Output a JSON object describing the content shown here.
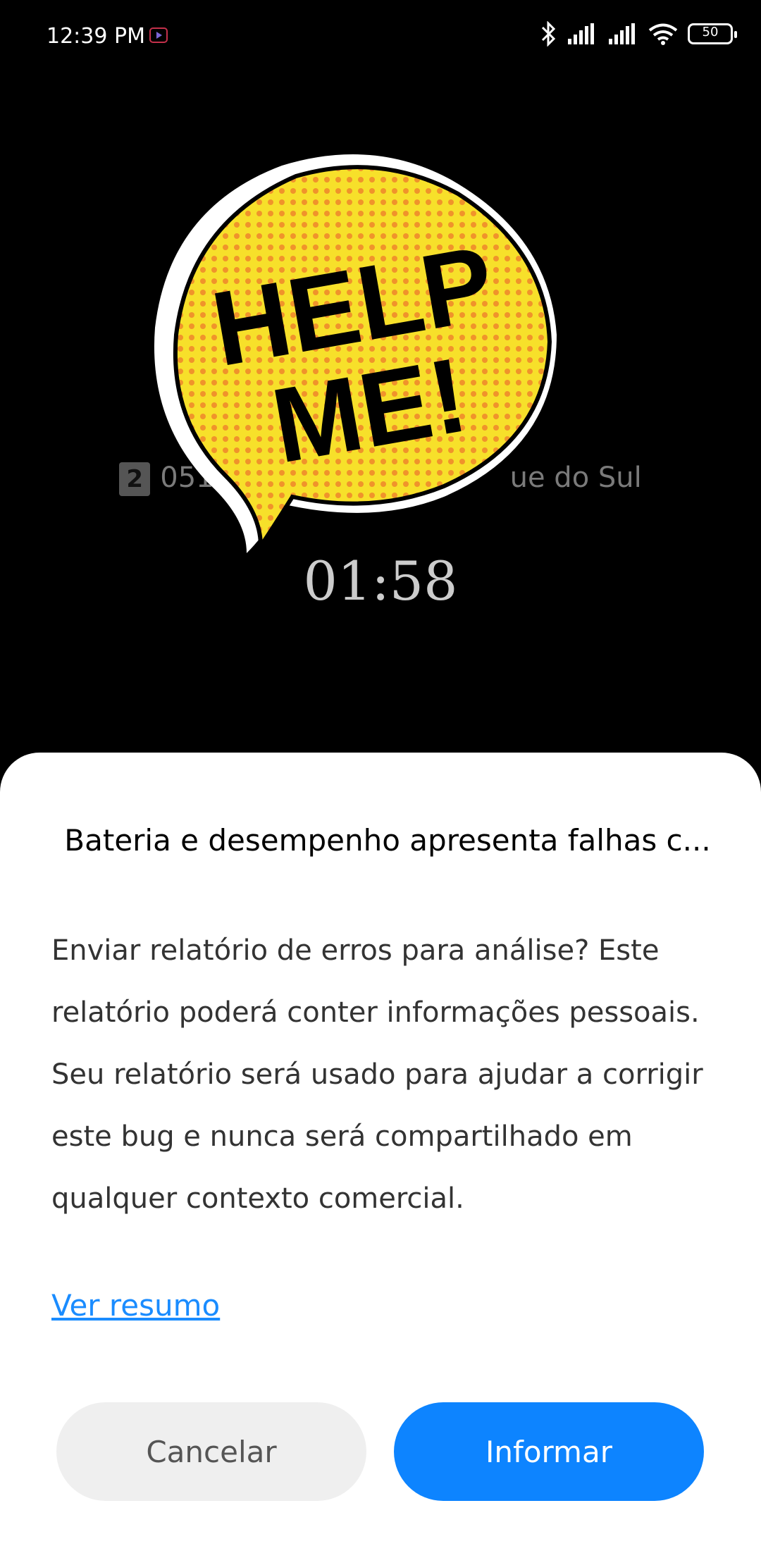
{
  "status_bar": {
    "time": "12:39 PM",
    "battery_level": "50"
  },
  "call": {
    "sim_slot": "2",
    "caller_left": "051",
    "caller_right": "ue do Sul",
    "timer": "01:58"
  },
  "overlay": {
    "line1": "HELP",
    "line2": "ME!"
  },
  "dialog": {
    "title": "Bateria e desempenho apresenta falhas c...",
    "body": "Enviar relatório de erros para análise? Este relatório poderá conter informações pessoais. Seu relatório será usado para ajudar a corrigir este bug e nunca será compartilhado em qualquer contexto comercial.",
    "link": "Ver resumo",
    "cancel_label": "Cancelar",
    "report_label": "Informar"
  },
  "colors": {
    "accent": "#0d84ff",
    "bubble_yellow": "#f7e02a",
    "bubble_dots": "#f0932b"
  }
}
